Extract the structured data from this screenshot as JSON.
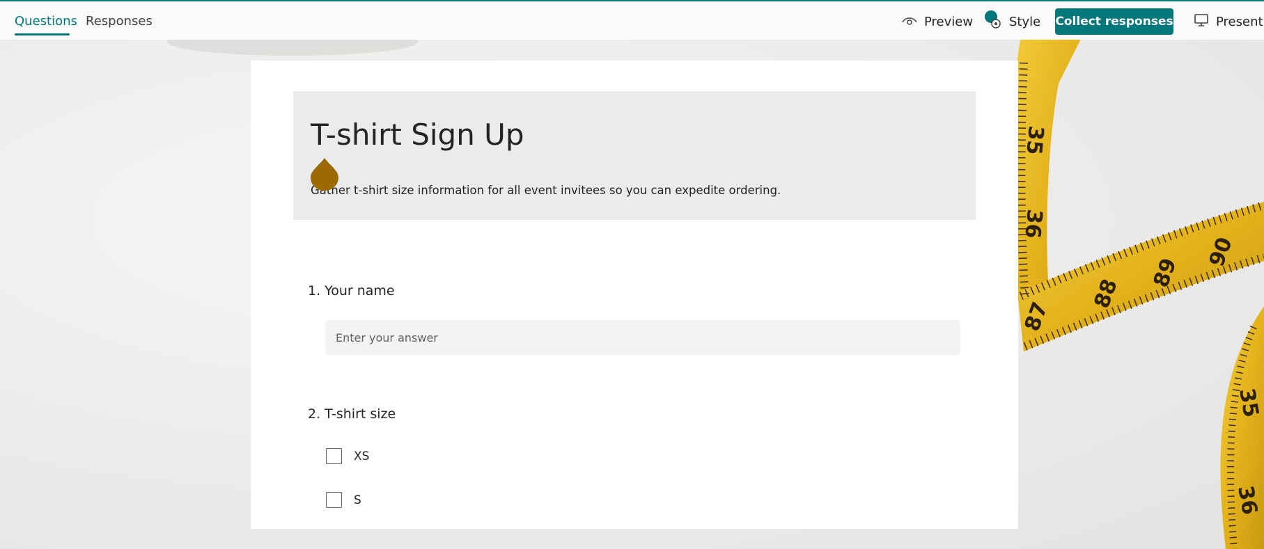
{
  "tabs": [
    {
      "label": "Questions",
      "active": true
    },
    {
      "label": "Responses",
      "active": false
    }
  ],
  "toolbar": {
    "preview_label": "Preview",
    "style_label": "Style",
    "collect_label": "Collect responses",
    "present_label": "Present"
  },
  "form": {
    "title": "T-shirt Sign Up",
    "description": "Gather t-shirt size information for all event invitees so you can expedite ordering.",
    "questions": [
      {
        "number": "1.",
        "text": "Your name",
        "placeholder": "Enter your answer"
      },
      {
        "number": "2.",
        "text": "T-shirt size",
        "options": [
          "XS",
          "S"
        ]
      }
    ]
  },
  "colors": {
    "accent": "#03787c",
    "theme_drop": "#9c6a00",
    "tape_yellow": "#e8b823"
  },
  "icons": [
    "eye-icon",
    "palette-icon",
    "monitor-icon",
    "theme-drop-icon"
  ]
}
